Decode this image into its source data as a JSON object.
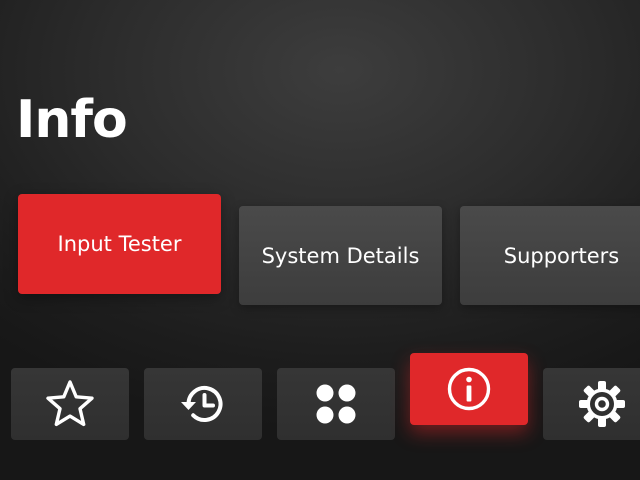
{
  "page": {
    "title": "Info"
  },
  "cards": [
    {
      "label": "Input Tester",
      "selected": true
    },
    {
      "label": "System Details",
      "selected": false
    },
    {
      "label": "Supporters",
      "selected": false
    }
  ],
  "nav": {
    "items": [
      {
        "icon": "star-icon",
        "selected": false
      },
      {
        "icon": "history-icon",
        "selected": false
      },
      {
        "icon": "apps-grid-icon",
        "selected": false
      },
      {
        "icon": "info-icon",
        "selected": true
      },
      {
        "icon": "gear-icon",
        "selected": false
      }
    ]
  },
  "colors": {
    "accent": "#e0282a",
    "card_inactive": "#444444",
    "nav_inactive": "#333333",
    "text": "#ffffff",
    "background": "#232323"
  }
}
